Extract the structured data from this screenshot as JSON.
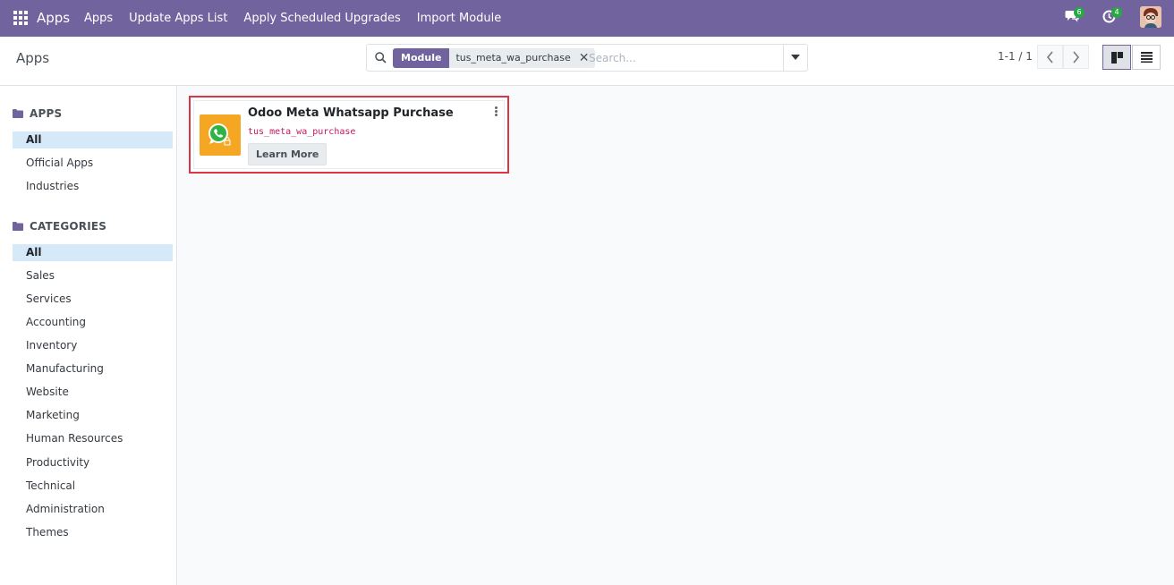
{
  "navbar": {
    "brand": "Apps",
    "menu": [
      "Apps",
      "Update Apps List",
      "Apply Scheduled Upgrades",
      "Import Module"
    ],
    "messages_count": "6",
    "activities_count": "4",
    "icons": [
      "apps-grid-icon",
      "chat-icon",
      "clock-icon",
      "user-avatar"
    ],
    "color": "#71639e"
  },
  "control": {
    "breadcrumb": "Apps",
    "search": {
      "facet_label": "Module",
      "facet_value": "tus_meta_wa_purchase",
      "placeholder": "Search..."
    },
    "pager": "1-1 / 1"
  },
  "sidebar": {
    "apps_heading": "APPS",
    "apps_items": [
      "All",
      "Official Apps",
      "Industries"
    ],
    "categories_heading": "CATEGORIES",
    "category_items": [
      "All",
      "Sales",
      "Services",
      "Accounting",
      "Inventory",
      "Manufacturing",
      "Website",
      "Marketing",
      "Human Resources",
      "Productivity",
      "Technical",
      "Administration",
      "Themes"
    ]
  },
  "card": {
    "title": "Odoo Meta Whatsapp Purchase",
    "technical_name": "tus_meta_wa_purchase",
    "button": "Learn More",
    "icon": "whatsapp-icon",
    "icon_bg": "#f5a623",
    "highlight_color": "#dc3545"
  }
}
